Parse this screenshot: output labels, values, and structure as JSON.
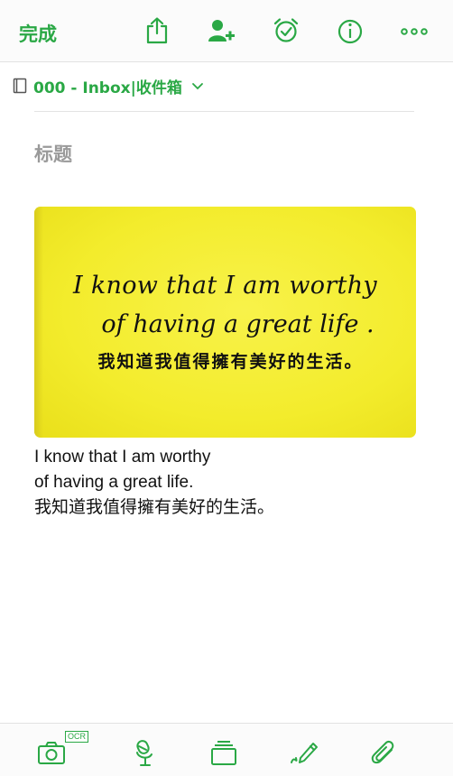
{
  "toolbar": {
    "done_label": "完成",
    "icons": [
      "share-icon",
      "add-user-icon",
      "reminder-icon",
      "info-icon",
      "more-icon"
    ]
  },
  "notebook": {
    "label": "000 - Inbox|收件箱",
    "icon": "notebook-icon"
  },
  "note": {
    "title_placeholder": "标题",
    "image_lines": [
      "I know that I am worthy",
      "of having a great life .",
      "我知道我值得擁有美好的生活。"
    ],
    "body_lines": [
      "I know that I am worthy",
      "of having a great life.",
      "我知道我值得擁有美好的生活。"
    ]
  },
  "bottom_bar": {
    "ocr_badge": "OCR",
    "icons": [
      "camera-icon",
      "microphone-icon",
      "stack-icon",
      "pen-icon",
      "paperclip-icon"
    ]
  },
  "colors": {
    "accent": "#2aa845",
    "image_background": "#f3ec2c"
  }
}
